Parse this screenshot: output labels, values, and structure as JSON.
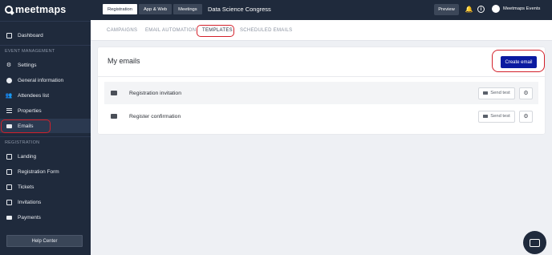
{
  "logo": {
    "text": "meetmaps"
  },
  "sidebar": {
    "items_top": [
      {
        "label": "Dashboard",
        "icon": "dashboard-icon"
      }
    ],
    "section_event": "EVENT MANAGEMENT",
    "items_event": [
      {
        "label": "Settings",
        "icon": "gear-icon"
      },
      {
        "label": "General information",
        "icon": "info-icon"
      },
      {
        "label": "Attendees list",
        "icon": "users-icon"
      },
      {
        "label": "Properties",
        "icon": "list-icon"
      },
      {
        "label": "Emails",
        "icon": "envelope-icon"
      }
    ],
    "section_registration": "REGISTRATION",
    "items_registration": [
      {
        "label": "Landing",
        "icon": "landing-icon"
      },
      {
        "label": "Registration Form",
        "icon": "form-icon"
      },
      {
        "label": "Tickets",
        "icon": "ticket-icon"
      },
      {
        "label": "Invitations",
        "icon": "invitation-icon"
      },
      {
        "label": "Payments",
        "icon": "card-icon"
      }
    ],
    "help": "Help Center"
  },
  "topbar": {
    "tabs": [
      "Registration",
      "App & Web",
      "Meetings"
    ],
    "event_title": "Data Science Congress",
    "preview": "Preview",
    "user": "Meetmaps Events"
  },
  "subtabs": [
    "CAMPAIGNS",
    "EMAIL AUTOMATION",
    "TEMPLATES",
    "SCHEDULED EMAILS"
  ],
  "main": {
    "title": "My emails",
    "create": "Create email",
    "send_test": "Send test",
    "rows": [
      "Registration invitation",
      "Register confirmation"
    ]
  },
  "colors": {
    "brand": "#1f2a3c",
    "accent": "#0a1aa0",
    "highlight": "#d3202a"
  }
}
